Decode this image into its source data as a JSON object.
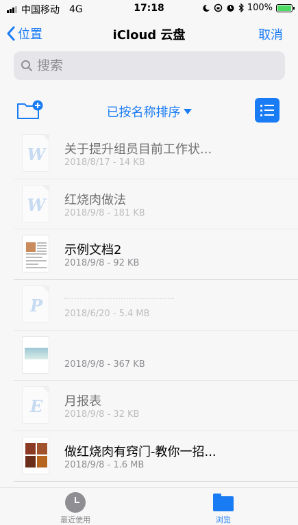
{
  "status_bar": {
    "carrier": "中国移动",
    "network": "4G",
    "time": "17:18",
    "battery_percent": "100%",
    "battery_level": 1.0
  },
  "nav": {
    "back_label": "位置",
    "title": "iCloud 云盘",
    "cancel_label": "取消"
  },
  "search": {
    "placeholder": "搜索"
  },
  "toolbar": {
    "sort_label": "已按名称排序"
  },
  "files": [
    {
      "name": "关于提升组员目前工作状...",
      "meta": "2018/8/17 - 14 KB",
      "type": "word",
      "letter": "W",
      "enabled": false
    },
    {
      "name": "红烧肉做法",
      "meta": "2018/9/8 - 181 KB",
      "type": "word",
      "letter": "W",
      "enabled": false
    },
    {
      "name": "示例文档2",
      "meta": "2018/9/8 - 92 KB",
      "type": "document",
      "letter": "",
      "enabled": true
    },
    {
      "name": "",
      "meta": "2018/6/20 - 5.4 MB",
      "type": "powerpoint",
      "letter": "P",
      "enabled": false
    },
    {
      "name": "",
      "meta": "2018/9/8 - 367 KB",
      "type": "image-doc",
      "letter": "",
      "enabled": true
    },
    {
      "name": "月报表",
      "meta": "2018/9/8 - 32 KB",
      "type": "excel",
      "letter": "E",
      "enabled": false
    },
    {
      "name": "做红烧肉有窍门-教你一招...",
      "meta": "2018/9/8 - 1.6 MB",
      "type": "photo-doc",
      "letter": "",
      "enabled": true
    }
  ],
  "tabs": {
    "recent_label": "最近使用",
    "browse_label": "浏览"
  },
  "colors": {
    "accent": "#1a7cf4",
    "battery": "#4cd964"
  }
}
